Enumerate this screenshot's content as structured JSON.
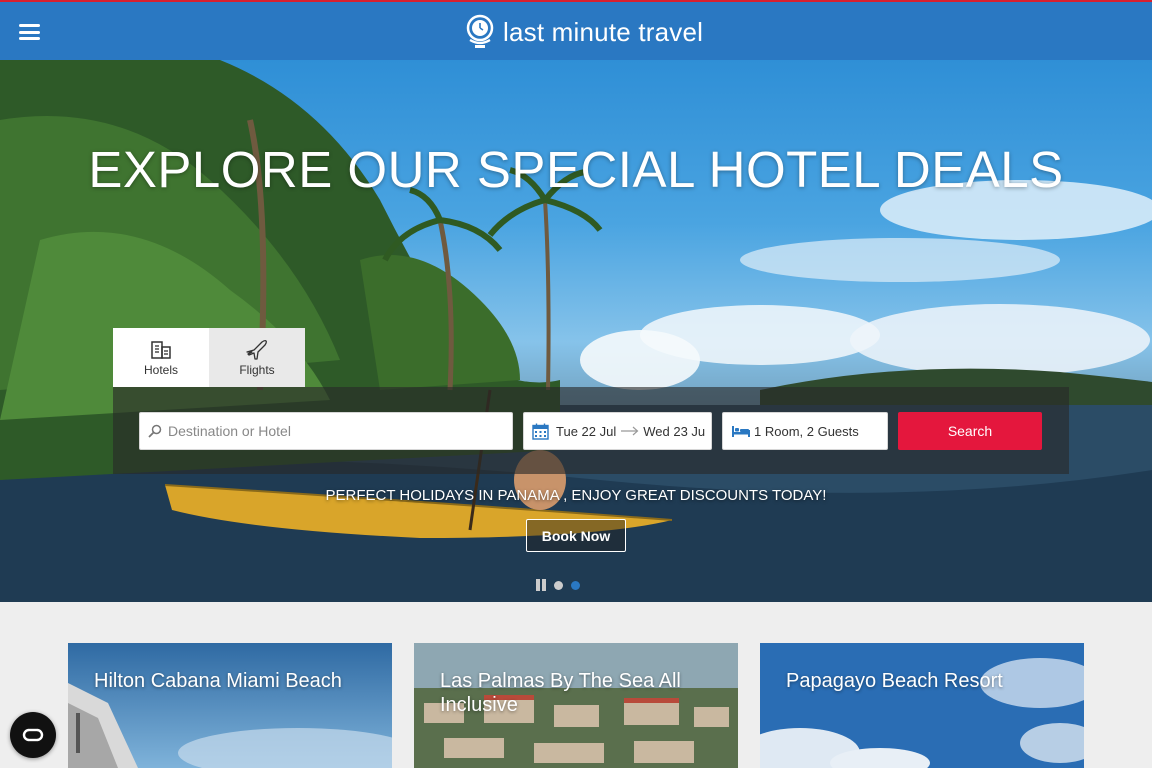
{
  "header": {
    "brand_name": "last minute travel",
    "menu_icon": "hamburger-icon",
    "logo_icon": "globe-clock-icon",
    "colors": {
      "bar": "#2a78c2",
      "top_stripe": "#d8202f"
    }
  },
  "hero": {
    "title": "EXPLORE OUR SPECIAL HOTEL DEALS",
    "tabs": [
      {
        "label": "Hotels",
        "icon": "hotel-icon",
        "active": true
      },
      {
        "label": "Flights",
        "icon": "plane-icon",
        "active": false
      }
    ],
    "search": {
      "destination_placeholder": "Destination or Hotel",
      "check_in": "Tue 22 Jul",
      "check_out": "Wed 23 Ju",
      "guests": "1 Room, 2 Guests",
      "search_label": "Search",
      "search_color": "#e4173d"
    },
    "promo_text": "PERFECT HOLIDAYS IN PANAMA , ENJOY GREAT DISCOUNTS TODAY!",
    "book_label": "Book Now",
    "carousel": {
      "slides": 2,
      "active_slide": 2
    }
  },
  "deals": [
    {
      "title": "Hilton Cabana Miami Beach"
    },
    {
      "title": "Las Palmas By The Sea All Inclusive"
    },
    {
      "title": "Papagayo Beach Resort"
    }
  ],
  "privacy_button": {
    "icon": "privacy-eye-icon"
  }
}
